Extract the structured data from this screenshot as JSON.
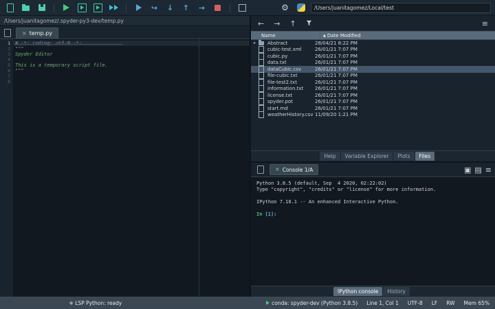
{
  "icons": {
    "close": "×",
    "back": "←",
    "forward": "→",
    "up": "↑",
    "menu": "≡",
    "gear": "⚙",
    "sort_asc": "▲",
    "chevron_right": "▸",
    "step_over": "↪",
    "step_into": "↓",
    "step_return": "↑",
    "continue": "→",
    "window": "▣",
    "clipboard": "▤",
    "lsp_dot": "●"
  },
  "toolbar": {
    "path_value": "/Users/juanitagomez/Local/test"
  },
  "editor": {
    "breadcrumb": "/Users/juanitagomez/.spyder-py3-dev/temp.py",
    "tab_label": "temp.py",
    "lines": [
      {
        "num": "1",
        "text": "# -*- coding: utf-8 -*-"
      },
      {
        "num": "2",
        "text": "\"\"\""
      },
      {
        "num": "3",
        "text": "Spyder Editor"
      },
      {
        "num": "4",
        "text": ""
      },
      {
        "num": "5",
        "text": "This is a temporary script file."
      },
      {
        "num": "6",
        "text": "\"\"\""
      },
      {
        "num": "7",
        "text": ""
      },
      {
        "num": "8",
        "text": ""
      }
    ]
  },
  "files": {
    "header": {
      "name": "Name",
      "date": "Date Modified"
    },
    "rows": [
      {
        "name": "Abstract",
        "date": "28/04/21 8:22 PM"
      },
      {
        "name": "cubic-test.xml",
        "date": "26/01/21 7:07 PM"
      },
      {
        "name": "cubic.py",
        "date": "26/01/21 7:07 PM"
      },
      {
        "name": "data.txt",
        "date": "26/01/21 7:07 PM"
      },
      {
        "name": "dataCubic.csv",
        "date": "26/01/21 7:07 PM"
      },
      {
        "name": "file-cubic.txt",
        "date": "26/01/21 7:07 PM"
      },
      {
        "name": "file-test2.txt",
        "date": "26/01/21 7:07 PM"
      },
      {
        "name": "information.txt",
        "date": "26/01/21 7:07 PM"
      },
      {
        "name": "license.txt",
        "date": "26/01/21 7:07 PM"
      },
      {
        "name": "spyder.pot",
        "date": "26/01/21 7:07 PM"
      },
      {
        "name": "start.md",
        "date": "26/01/21 7:07 PM"
      },
      {
        "name": "weatherHistory.csv",
        "date": "11/09/20 1:21 PM"
      }
    ]
  },
  "panel_tabs": {
    "help": "Help",
    "variable_explorer": "Variable Explorer",
    "plots": "Plots",
    "files": "Files"
  },
  "console": {
    "tab_label": "Console 1/A",
    "banner1": "Python 3.8.5 (default, Sep  4 2020, 02:22:02)",
    "banner2": "Type \"copyright\", \"credits\" or \"license\" for more information.",
    "banner3": "IPython 7.18.1 -- An enhanced Interactive Python.",
    "prompt_in": "In",
    "prompt_num": "[1]:"
  },
  "console_tabs": {
    "ipython": "IPython console",
    "history": "History"
  },
  "statusbar": {
    "lsp": "LSP Python: ready",
    "conda": "conda: spyder-dev (Python 3.8.5)",
    "cursor": "Line 1, Col 1",
    "encoding": "UTF-8",
    "eol": "LF",
    "permissions": "RW",
    "memory": "Mem 65%"
  }
}
